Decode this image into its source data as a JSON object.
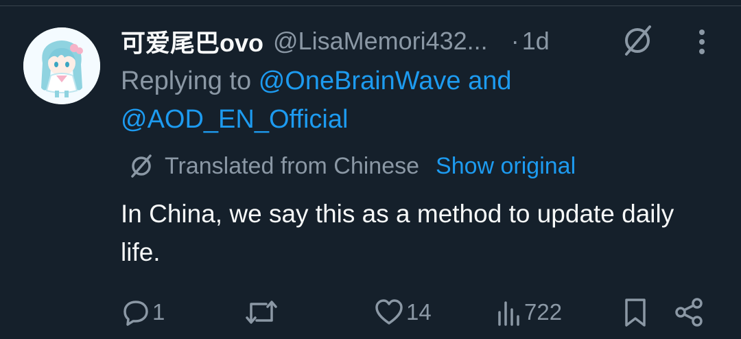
{
  "tweet": {
    "display_name": "可爱尾巴ovo",
    "handle": "@LisaMemori432...",
    "separator": "·",
    "time": "1d",
    "replying_prefix": "Replying to",
    "mention_1": "@OneBrainWave",
    "mention_joiner": "and",
    "mention_2": "@AOD_EN_Official",
    "translated_label": "Translated from Chinese",
    "show_original_label": "Show original",
    "text": "In China, we say this as a method to update daily life."
  },
  "actions": {
    "reply_count": "1",
    "retweet_count": "",
    "like_count": "14",
    "views_count": "722"
  },
  "icons": {
    "header_translate": "translate-icon",
    "more": "more-vertical-icon",
    "reply": "reply-icon",
    "retweet": "retweet-icon",
    "like": "heart-icon",
    "views": "views-chart-icon",
    "bookmark": "bookmark-icon",
    "share": "share-icon"
  },
  "colors": {
    "background": "#15202b",
    "primary_text": "#f7f9f9",
    "secondary_text": "#8b98a5",
    "link": "#1d9bf0",
    "divider": "#38444d"
  }
}
